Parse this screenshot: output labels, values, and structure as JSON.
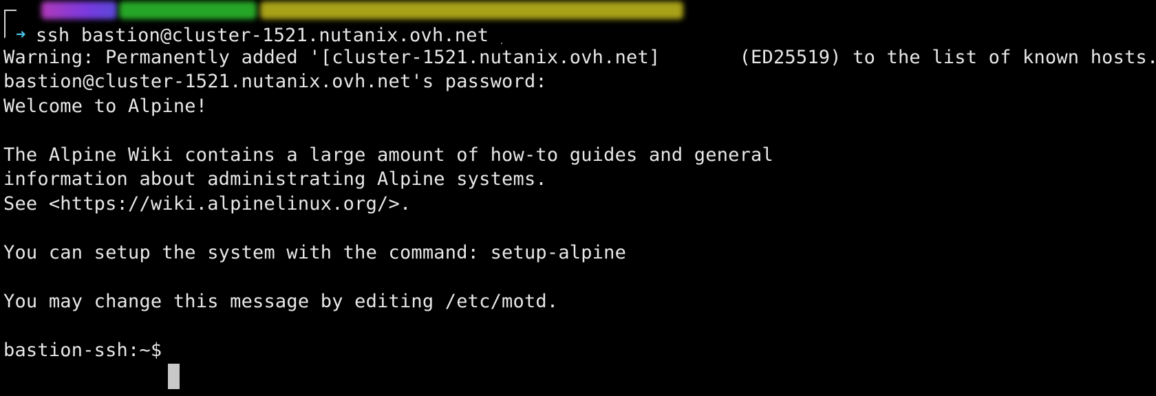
{
  "terminal": {
    "prompt_top": {
      "blurred": true
    },
    "command": "ssh bastion@cluster-1521.nutanix.ovh.net",
    "output": [
      "Warning: Permanently added '[cluster-1521.nutanix.ovh.net]       (ED25519) to the list of known hosts.",
      "bastion@cluster-1521.nutanix.ovh.net's password:",
      "Welcome to Alpine!",
      "",
      "The Alpine Wiki contains a large amount of how-to guides and general",
      "information about administrating Alpine systems.",
      "See <https://wiki.alpinelinux.org/>.",
      "",
      "You can setup the system with the command: setup-alpine",
      "",
      "You may change this message by editing /etc/motd.",
      ""
    ],
    "prompt": "bastion-ssh:~$ ",
    "colors": {
      "background": "#000000",
      "foreground": "#e8e8e8",
      "arrow": "#49c2e8",
      "prompt_user": "#b03ab8",
      "prompt_host": "#26a626",
      "prompt_path": "#a8a218"
    }
  }
}
